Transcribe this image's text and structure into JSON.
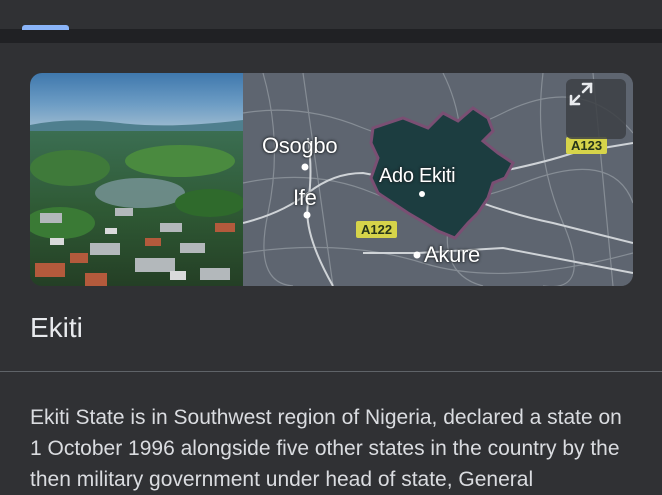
{
  "entity": {
    "title": "Ekiti",
    "description": "Ekiti State is in Southwest region of Nigeria, declared a state on 1 October 1996 alongside five other states in the country by the then military government under head of state, General"
  },
  "map": {
    "cities": {
      "osogbo": "Osogbo",
      "ife": "Ife",
      "ado_ekiti": "Ado Ekiti",
      "akure": "Akure"
    },
    "roads": {
      "a122": "A122",
      "a123": "A123"
    },
    "expand_icon": "expand-icon"
  },
  "colors": {
    "background": "#303134",
    "region_fill": "#1c3d40",
    "road_badge": "#d6d44a",
    "tab_indicator": "#8ab4f8"
  }
}
